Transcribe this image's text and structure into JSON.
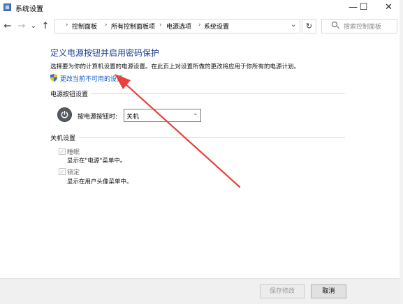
{
  "window": {
    "title": "系统设置",
    "minimize_glyph": "—",
    "maximize_glyph": "☐",
    "close_glyph": "✕"
  },
  "nav": {
    "back_glyph": "←",
    "forward_glyph": "→",
    "dropdown_glyph": "⌄",
    "up_glyph": "↑",
    "breadcrumb": [
      "控制面板",
      "所有控制面板项",
      "电源选项",
      "系统设置"
    ],
    "breadcrumb_sep": "›",
    "address_dropdown_glyph": "⌄",
    "refresh_glyph": "↻",
    "search_placeholder": "搜索控制面板"
  },
  "content": {
    "heading": "定义电源按钮并启用密码保护",
    "description": "选择要为你的计算机设置的电源设置。在此页上对设置所做的更改将应用于你所有的电源计划。",
    "change_link": "更改当前不可用的设置",
    "power_button_section": {
      "title": "电源按钮设置",
      "label": "按电源按钮时:",
      "selected": "关机"
    },
    "shutdown_section": {
      "title": "关机设置",
      "items": [
        {
          "label": "睡眠",
          "desc": "显示在\"电源\"菜单中。",
          "checked": true
        },
        {
          "label": "锁定",
          "desc": "显示在用户头像菜单中。",
          "checked": true
        }
      ]
    }
  },
  "footer": {
    "save_label": "保存修改",
    "cancel_label": "取消"
  },
  "icons": {
    "app": "power-options-icon",
    "shield": "uac-shield-icon",
    "power": "power-icon",
    "search": "search-icon"
  },
  "colors": {
    "heading": "#1d3c8f",
    "link": "#0b56c8",
    "arrow": "#e8413a"
  }
}
